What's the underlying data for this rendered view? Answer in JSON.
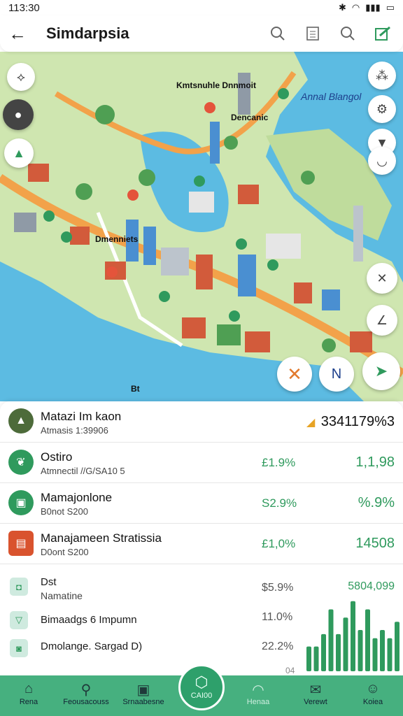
{
  "status_bar": {
    "time": "113:30",
    "icons": [
      "bluetooth-icon",
      "wifi-icon",
      "signal-icon",
      "battery-icon"
    ]
  },
  "app_bar": {
    "title": "Simdarpsia",
    "actions": [
      "search-icon",
      "calculator-icon",
      "search-icon",
      "edit-icon"
    ]
  },
  "map": {
    "labels": [
      {
        "id": "tl",
        "text": "Kmtsnuhle Dnnmoit"
      },
      {
        "id": "c",
        "text": "Dencanic"
      },
      {
        "id": "r",
        "text": "Annal Blangol"
      },
      {
        "id": "m",
        "text": "Dmenniets"
      },
      {
        "id": "bl",
        "text": "Bt"
      }
    ]
  },
  "panel": {
    "header": {
      "title": "Matazi Im kaon",
      "subtitle": "Atmasis 1:39906",
      "value": "3341179%3"
    },
    "rows": [
      {
        "title": "Ostiro",
        "subtitle": "Atmnectil //G/SA10 5",
        "pct": "£1.9%",
        "value": "1,1,98"
      },
      {
        "title": "Mamajonlone",
        "subtitle": "B0not S200",
        "pct": "S2.9%",
        "value": "%.9%"
      },
      {
        "title": "Manajameen Stratissia",
        "subtitle": "D0ont S200",
        "pct": "£1,0%",
        "value": "14508"
      }
    ],
    "chart_section": {
      "items": [
        {
          "title": "Dst",
          "subtitle": "Namatine"
        },
        {
          "title": "Bimaadgs 6 Impumn"
        },
        {
          "title": "Dmolange. Sargad D)"
        }
      ],
      "pcts": [
        "$5.9%",
        "11.0%",
        "22.2%"
      ],
      "top_value": "5804,099",
      "bottom_value": "04"
    }
  },
  "chart_data": {
    "type": "bar",
    "values": [
      3,
      3,
      4.5,
      7.5,
      4.5,
      6.5,
      8.5,
      5,
      7.5,
      4,
      5,
      4,
      6
    ]
  },
  "tabs": [
    {
      "label": "Rena",
      "icon": "home-icon"
    },
    {
      "label": "Feousacouss",
      "icon": "search-icon"
    },
    {
      "label": "Srnaabesne",
      "icon": "briefcase-icon"
    },
    {
      "label": "CAI00",
      "icon": "hexagon-icon"
    },
    {
      "label": "Henaa",
      "icon": "wifi-icon"
    },
    {
      "label": "Verewt",
      "icon": "message-icon"
    },
    {
      "label": "Koiea",
      "icon": "profile-icon"
    }
  ]
}
